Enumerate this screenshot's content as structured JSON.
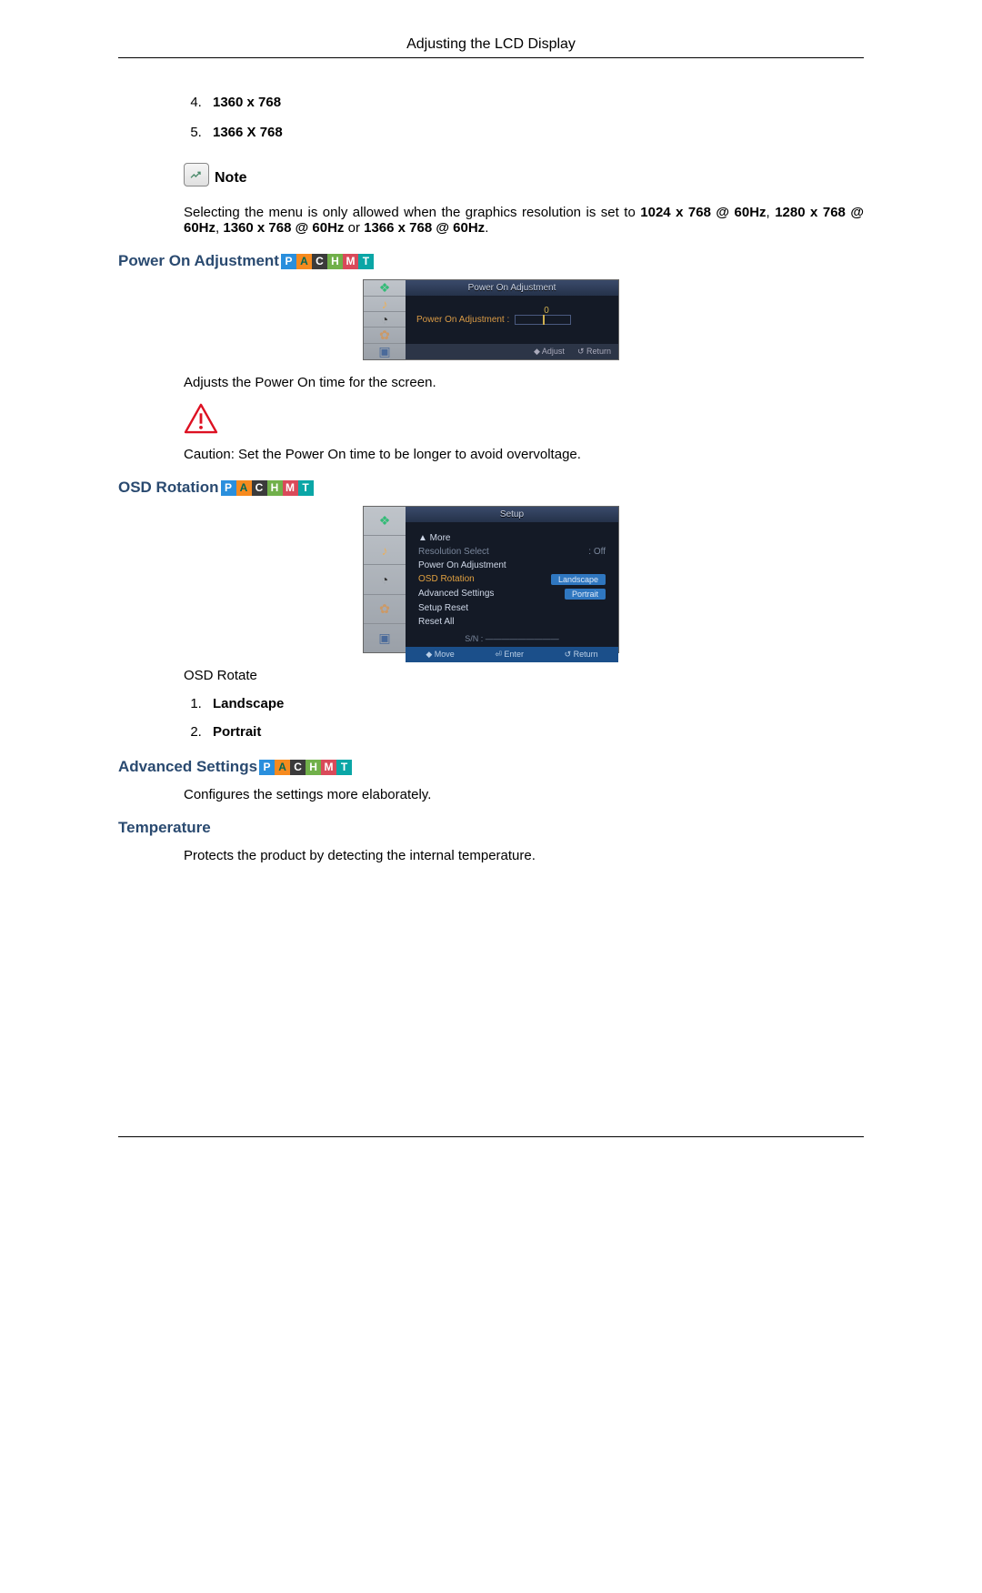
{
  "header": {
    "title": "Adjusting the LCD Display"
  },
  "resolutions": {
    "start": 4,
    "items": [
      "1360 x 768",
      "1366 X 768"
    ]
  },
  "note": {
    "label": "Note",
    "text_pre": "Selecting the menu is only allowed when the graphics resolution is set to ",
    "b1": "1024 x 768 @ 60Hz",
    "s1": ", ",
    "b2": "1280 x 768 @ 60Hz",
    "s2": ", ",
    "b3": "1360 x 768 @ 60Hz",
    "s3": " or ",
    "b4": "1366 x 768 @ 60Hz",
    "tail": "."
  },
  "modes": {
    "p": "P",
    "a": "A",
    "c": "C",
    "h": "H",
    "m": "M",
    "t": "T"
  },
  "power_on": {
    "heading": "Power On Adjustment",
    "osd_title": "Power On Adjustment",
    "osd_label": "Power On Adjustment :",
    "osd_value": "0",
    "footer_adjust": "◆ Adjust",
    "footer_return": "↺ Return",
    "desc": "Adjusts the Power On time for the screen.",
    "caution": "Caution: Set the Power On time to be longer to avoid overvoltage."
  },
  "osd_rotation": {
    "heading": "OSD Rotation",
    "osd_title": "Setup",
    "menu": {
      "more": "▲   More",
      "res_select": "Resolution Select",
      "res_value": ": Off",
      "power_on_adj": "Power On Adjustment",
      "osd_rotation": "OSD Rotation",
      "opt_landscape": "Landscape",
      "advanced": "Advanced Settings",
      "opt_portrait": "Portrait",
      "setup_reset": "Setup Reset",
      "reset_all": "Reset All",
      "sn_label": "S/N :"
    },
    "footer_move": "◆ Move",
    "footer_enter": "⏎ Enter",
    "footer_return": "↺ Return",
    "desc": "OSD Rotate",
    "options": [
      "Landscape",
      "Portrait"
    ]
  },
  "advanced": {
    "heading": "Advanced Settings",
    "desc": "Configures the settings more elaborately."
  },
  "temperature": {
    "heading": "Temperature",
    "desc": "Protects the product by detecting the internal temperature."
  }
}
